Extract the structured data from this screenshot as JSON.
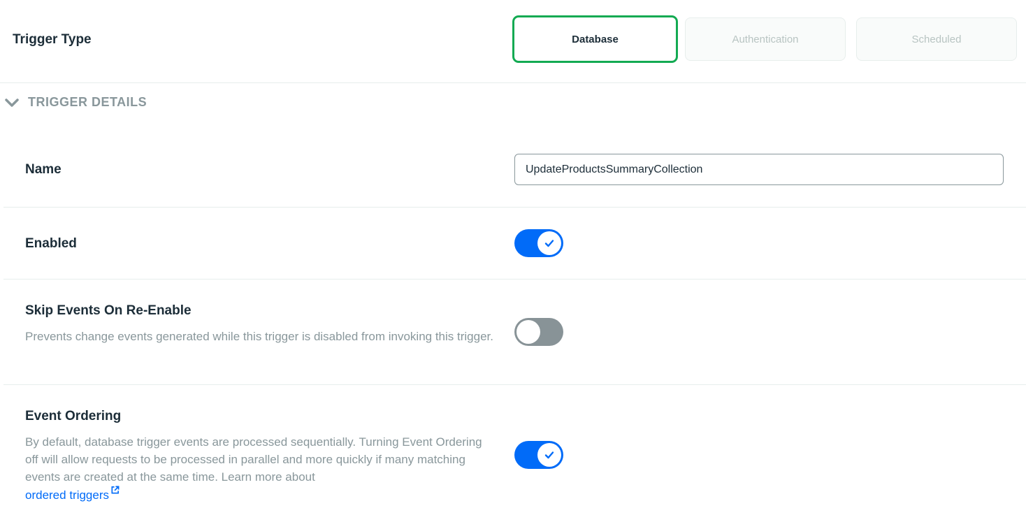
{
  "trigger_type": {
    "label": "Trigger Type",
    "options": [
      {
        "label": "Database",
        "state": "selected"
      },
      {
        "label": "Authentication",
        "state": "disabled"
      },
      {
        "label": "Scheduled",
        "state": "disabled"
      }
    ]
  },
  "details": {
    "section_title": "TRIGGER DETAILS",
    "icon": "chevron-down-icon",
    "name": {
      "label": "Name",
      "value": "UpdateProductsSummaryCollection"
    },
    "enabled": {
      "label": "Enabled",
      "on": true
    },
    "skip_events": {
      "label": "Skip Events On Re-Enable",
      "description": "Prevents change events generated while this trigger is disabled from invoking this trigger.",
      "on": false
    },
    "event_ordering": {
      "label": "Event Ordering",
      "description": "By default, database trigger events are processed sequentially. Turning Event Ordering off will allow requests to be processed in parallel and more quickly if many matching events are created at the same time. Learn more about",
      "link_text": "ordered triggers",
      "link_icon": "external-link-icon",
      "on": true
    }
  },
  "colors": {
    "selected_border": "#13aa52",
    "toggle_on": "#016bf8",
    "toggle_off": "#889397",
    "link": "#016bf8"
  }
}
